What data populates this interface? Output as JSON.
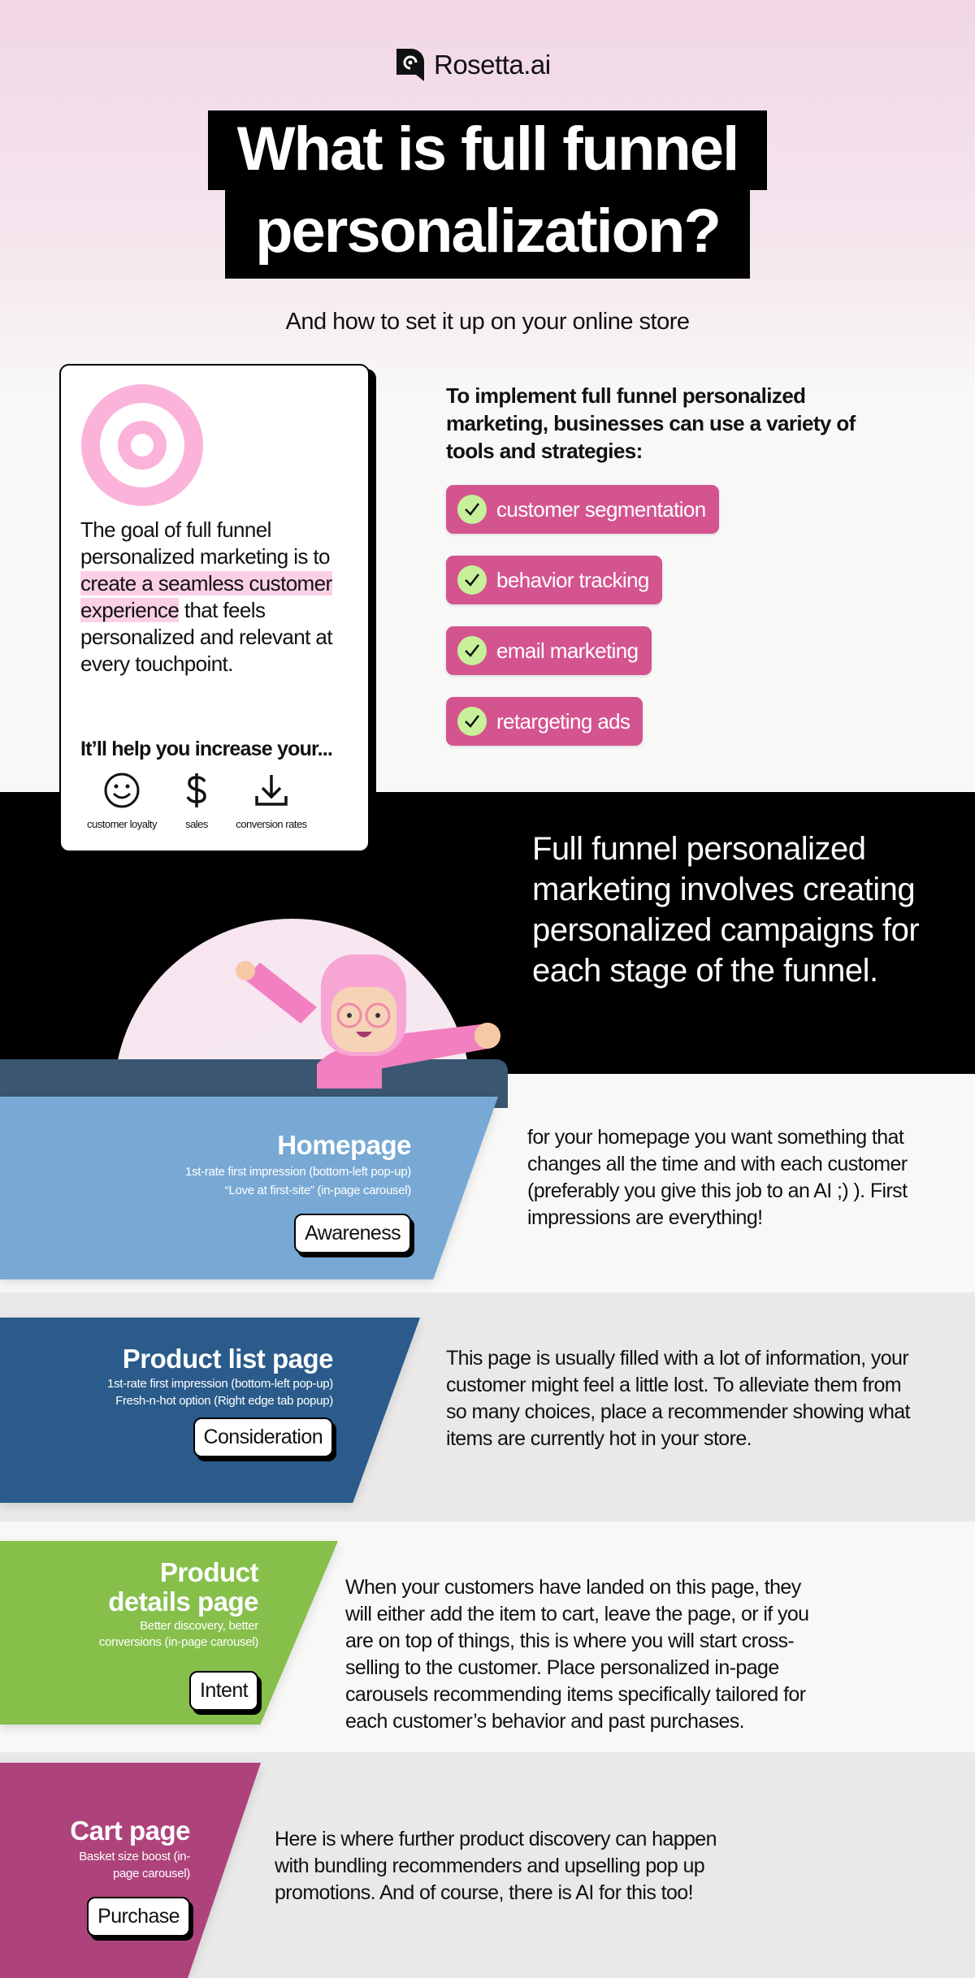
{
  "brand": {
    "name": "Rosetta.ai"
  },
  "title": {
    "line1": "What is full funnel",
    "line2": "personalization?",
    "subtitle": "And how to set it up on your online store"
  },
  "card": {
    "goal_before": "The goal of full funnel personalized marketing is to ",
    "goal_highlight": "create a seamless customer experience",
    "goal_after": " that feels personalized and relevant at every touchpoint.",
    "help_heading": "It’ll help you increase your...",
    "benefits": [
      {
        "label": "customer loyalty",
        "icon": "smiley-icon"
      },
      {
        "label": "sales",
        "icon": "dollar-icon"
      },
      {
        "label": "conversion rates",
        "icon": "download-icon"
      }
    ]
  },
  "tools": {
    "intro": "To implement full funnel personalized marketing, businesses can use a variety of tools and strategies:",
    "items": [
      "customer segmentation",
      "behavior tracking",
      "email marketing",
      "retargeting ads"
    ]
  },
  "headline": "Full funnel personalized marketing involves creating personalized campaigns for each stage of the funnel.",
  "stages": [
    {
      "title": "Homepage",
      "subs": [
        "1st-rate first impression (bottom-left pop-up)",
        "“Love at first-site” (in-page carousel)"
      ],
      "badge": "Awareness",
      "body": "for your homepage you want something that changes all the time and with each customer (preferably you give this job to an AI ;) ). First impressions are everything!",
      "color": "#78a9d4"
    },
    {
      "title": "Product list page",
      "subs": [
        "1st-rate first impression (bottom-left pop-up)",
        "Fresh-n-hot option (Right edge tab popup)"
      ],
      "badge": "Consideration",
      "body": "This page is usually filled with a lot of information, your customer might feel a little lost. To alleviate them from so many choices, place a recommender showing what items are currently hot in your store.",
      "color": "#2a5b8a"
    },
    {
      "title": "Product details page",
      "subs": [
        "Better discovery, better conversions (in-page carousel)"
      ],
      "badge": "Intent",
      "body": "When your customers have landed on this page, they will either add the item to cart, leave the page, or if you are on top of things, this is where you will start cross-selling to the customer. Place personalized in-page carousels recommending items specifically tailored for each customer’s behavior and past purchases.",
      "color": "#86bf4a"
    },
    {
      "title": "Cart page",
      "subs": [
        "Basket size boost (in-page carousel)"
      ],
      "badge": "Purchase",
      "body": " Here is where further product discovery can happen with bundling recommenders and upselling pop up promotions. And of course, there is AI for this too!",
      "color": "#ad437a"
    }
  ],
  "colors": {
    "pill": "#d4548f",
    "check": "#c8ef9a",
    "highlight": "#fbd0e6",
    "target": "#fbb3d9"
  }
}
